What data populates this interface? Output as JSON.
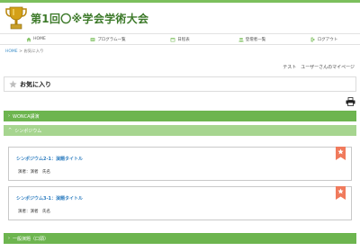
{
  "site": {
    "title": "第1回〇※学会学術大会"
  },
  "nav": [
    {
      "label": "HOME",
      "icon": "home-icon"
    },
    {
      "label": "プログラム一覧",
      "icon": "list-icon"
    },
    {
      "label": "日程表",
      "icon": "calendar-icon"
    },
    {
      "label": "登壇者一覧",
      "icon": "users-icon"
    },
    {
      "label": "ログアウト",
      "icon": "logout-icon"
    }
  ],
  "breadcrumb": {
    "home": "HOME",
    "separator": ">",
    "current": "お気に入り"
  },
  "user": {
    "mypage": "テスト　ユーザーさんのマイページ"
  },
  "favorites": {
    "title": "お気に入り"
  },
  "sections": [
    {
      "label": "WONCA講演",
      "state": "collapsed"
    },
    {
      "label": "シンポジウム",
      "state": "expanded"
    },
    {
      "label": "一般演題（口頭）",
      "state": "collapsed"
    }
  ],
  "cards": [
    {
      "title": "シンポジウム2-1：演題タイトル",
      "presenter": "演者：演者　氏名"
    },
    {
      "title": "シンポジウム3-1：演題タイトル",
      "presenter": "演者：演者　氏名"
    }
  ],
  "colors": {
    "accent": "#6db54f",
    "accent_light": "#a6d58f",
    "link": "#2f7ec0",
    "bookmark": "#f07a5c"
  }
}
